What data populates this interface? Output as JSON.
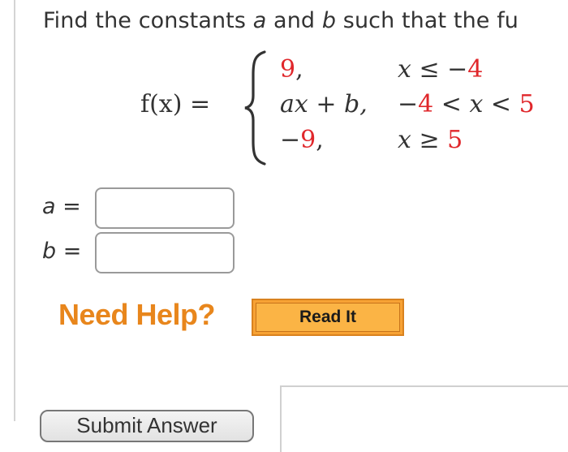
{
  "question": {
    "prefix": "Find the constants ",
    "var_a": "a",
    "middle": " and ",
    "var_b": "b",
    "suffix": " such that the fu"
  },
  "function_def": {
    "lhs": "f(x) =",
    "pieces": [
      {
        "value_prefix": "",
        "value_red": "9",
        "value_suffix": ",",
        "cond_prefix": "x ≤ −",
        "cond_red1": "4",
        "cond_mid": "",
        "cond_red2": ""
      },
      {
        "value_text": "ax + b,",
        "cond_prefix": "−",
        "cond_red1": "4",
        "cond_mid": " < x < ",
        "cond_red2": "5"
      },
      {
        "value_prefix": "−",
        "value_red": "9",
        "value_suffix": ",",
        "cond_prefix": "x ≥ ",
        "cond_red1": "5",
        "cond_mid": "",
        "cond_red2": ""
      }
    ]
  },
  "answers": {
    "a_label_var": "a",
    "b_label_var": "b",
    "equals": "=",
    "a_value": "",
    "b_value": ""
  },
  "help": {
    "label": "Need Help?",
    "read_it": "Read It"
  },
  "submit": {
    "label": "Submit Answer"
  },
  "colors": {
    "highlight_red": "#e0272b",
    "help_orange": "#e8861c",
    "button_orange": "#fbb445"
  }
}
